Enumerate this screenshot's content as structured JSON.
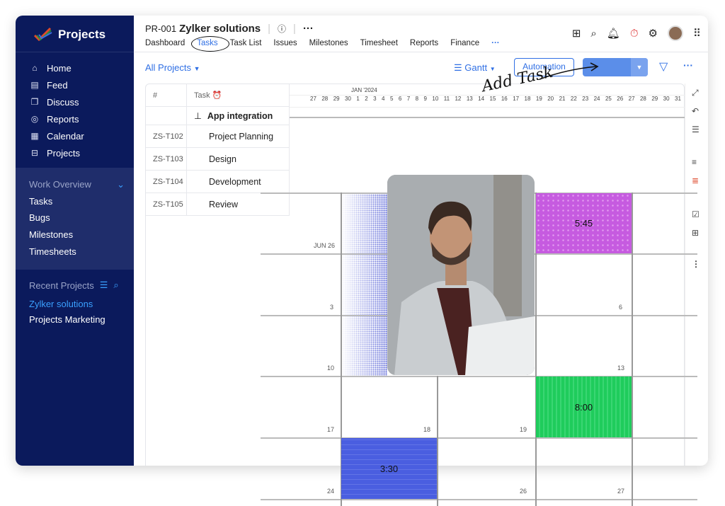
{
  "sidebar": {
    "app_title": "Projects",
    "nav": [
      {
        "label": "Home",
        "icon": "home-icon"
      },
      {
        "label": "Feed",
        "icon": "feed-icon"
      },
      {
        "label": "Discuss",
        "icon": "discuss-icon"
      },
      {
        "label": "Reports",
        "icon": "reports-icon"
      },
      {
        "label": "Calendar",
        "icon": "calendar-icon"
      },
      {
        "label": "Projects",
        "icon": "briefcase-icon"
      }
    ],
    "work_overview": {
      "title": "Work Overview",
      "items": [
        "Tasks",
        "Bugs",
        "Milestones",
        "Timesheets"
      ]
    },
    "recent": {
      "title": "Recent Projects",
      "items": [
        "Zylker solutions",
        "Projects Marketing"
      ]
    }
  },
  "header": {
    "project_id": "PR-001",
    "project_name": "Zylker solutions",
    "tabs": [
      "Dashboard",
      "Tasks",
      "Task List",
      "Issues",
      "Milestones",
      "Timesheet",
      "Reports",
      "Finance"
    ],
    "active_tab": "Tasks"
  },
  "toolbar": {
    "project_filter": "All Projects",
    "view": "Gantt",
    "automation": "Automation",
    "annotation": "Add Task"
  },
  "table": {
    "col_id": "#",
    "col_task": "Task",
    "group": "App integration",
    "rows": [
      {
        "id": "ZS-T102",
        "task": "Project Planning"
      },
      {
        "id": "ZS-T103",
        "task": "Design"
      },
      {
        "id": "ZS-T104",
        "task": "Development"
      },
      {
        "id": "ZS-T105",
        "task": "Review"
      }
    ]
  },
  "gantt": {
    "month": "JAN '2024",
    "days": [
      "27",
      "28",
      "29",
      "30",
      "1",
      "2",
      "3",
      "4",
      "5",
      "6",
      "7",
      "8",
      "9",
      "10",
      "11",
      "12",
      "13",
      "14",
      "15",
      "16",
      "17",
      "18",
      "19",
      "20",
      "21",
      "22",
      "23",
      "24",
      "25",
      "26",
      "27",
      "28",
      "29",
      "30",
      "31"
    ]
  },
  "calendar": {
    "dates": {
      "r1": "JUN 26",
      "r2a": "3",
      "r2b": "6",
      "r3a": "10",
      "r3b": "13",
      "r4a": "17",
      "r4b": "18",
      "r4c": "19",
      "r5a": "24",
      "r5b": "26",
      "r5c": "27"
    },
    "events": [
      {
        "time": "5:45",
        "color": "#c65be0"
      },
      {
        "time": "8:00",
        "color": "#1fcc5c"
      },
      {
        "time": "3:30",
        "color": "#4a5ee0"
      }
    ]
  },
  "colors": {
    "sidebar": "#0b1a5c",
    "accent": "#2f6fe4"
  }
}
